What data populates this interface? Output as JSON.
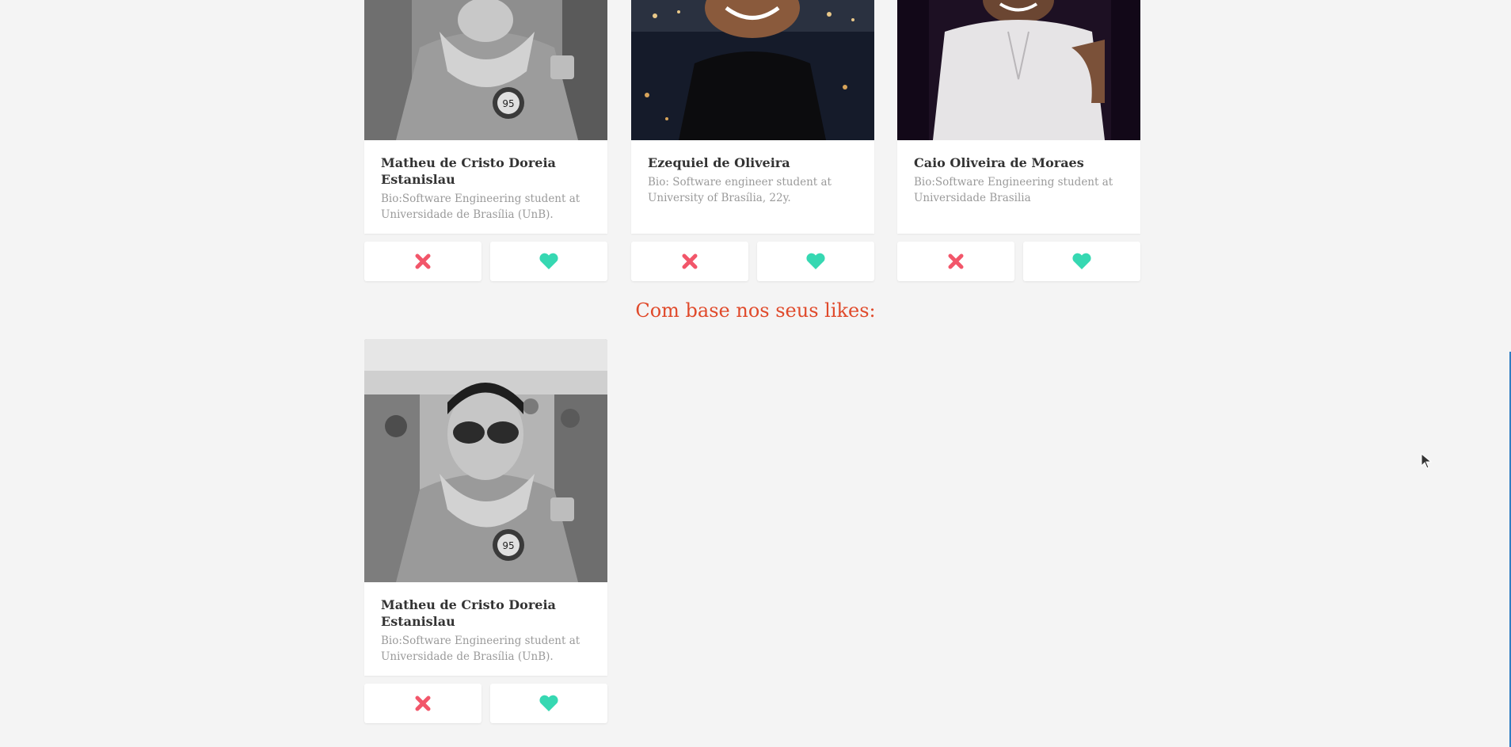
{
  "colors": {
    "background": "#f4f4f4",
    "accent": "#e04a2b",
    "dislike": "#f2566a",
    "like": "#36d8b2"
  },
  "icons": {
    "dislike": "close-icon",
    "like": "heart-icon"
  },
  "top_cards": [
    {
      "name": "Matheu de Cristo Doreia Estanislau",
      "bio": "Bio:Software Engineering student at Universidade de Brasília (UnB)."
    },
    {
      "name": "Ezequiel de Oliveira",
      "bio": "Bio:  Software engineer student at University of Brasília, 22y."
    },
    {
      "name": "Caio Oliveira de Moraes",
      "bio": "Bio:Software Engineering student at Universidade Brasilia"
    }
  ],
  "recommendations": {
    "title": "Com base nos seus likes:",
    "cards": [
      {
        "name": "Matheu de Cristo Doreia Estanislau",
        "bio": "Bio:Software Engineering student at Universidade de Brasília (UnB)."
      }
    ]
  }
}
